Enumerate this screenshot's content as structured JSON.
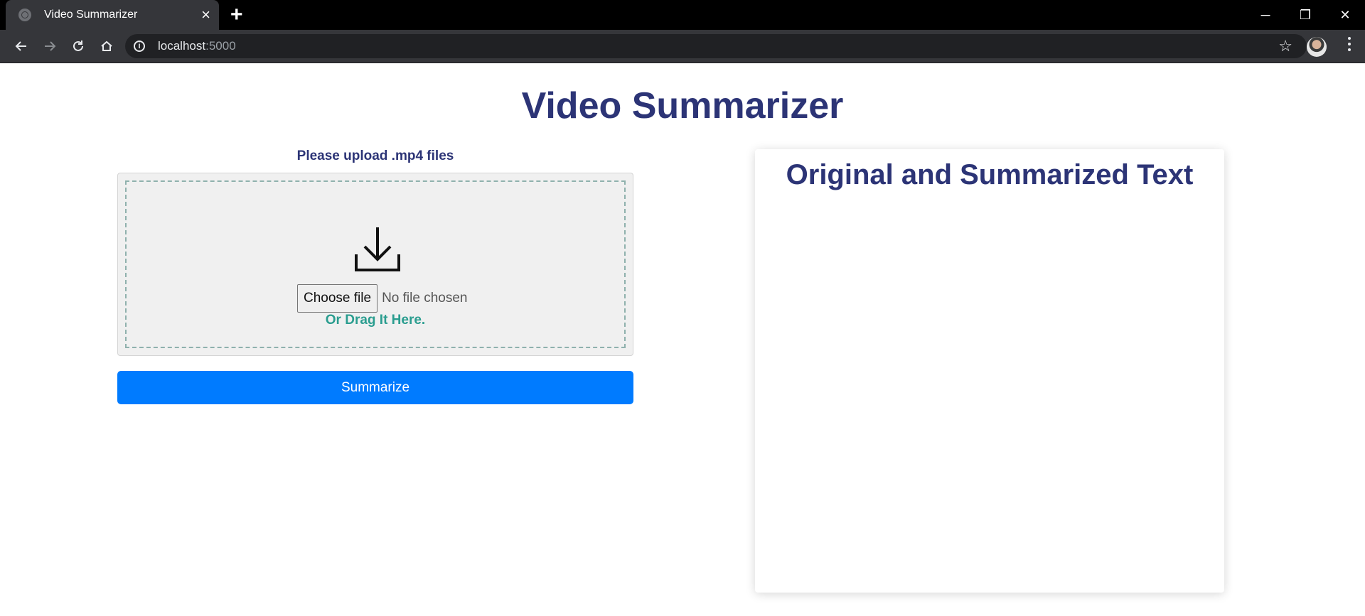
{
  "browser": {
    "tab_title": "Video Summarizer",
    "tab_close": "×",
    "new_tab": "+",
    "url_host": "localhost",
    "url_port": ":5000",
    "window_controls": {
      "minimize": "─",
      "restore": "❐",
      "close": "✕"
    }
  },
  "page": {
    "title": "Video Summarizer",
    "upload_note": "Please upload .mp4 files",
    "choose_file_label": "Choose file",
    "file_status": "No file chosen",
    "drag_text": "Or Drag It Here.",
    "summarize_label": "Summarize",
    "result_title": "Original and Summarized Text"
  },
  "colors": {
    "heading": "#2c3476",
    "accent_button": "#007bff",
    "drag_text": "#2a9d8f"
  },
  "icons": [
    "globe-icon",
    "back-icon",
    "forward-icon",
    "reload-icon",
    "home-icon",
    "info-icon",
    "star-icon",
    "menu-icon",
    "download-icon"
  ]
}
